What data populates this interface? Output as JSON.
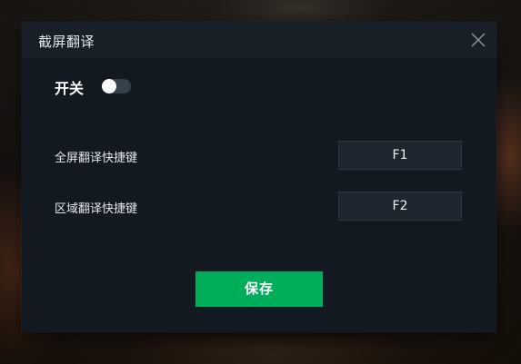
{
  "dialog": {
    "title": "截屏翻译",
    "close_icon": "close-icon"
  },
  "toggle": {
    "label": "开关",
    "state": "off"
  },
  "hotkeys": [
    {
      "label": "全屏翻译快捷键",
      "value": "F1"
    },
    {
      "label": "区域翻译快捷键",
      "value": "F2"
    }
  ],
  "footer": {
    "save_label": "保存"
  },
  "colors": {
    "accent": "#00ad5a",
    "dialog_bg": "#131920",
    "titlebar_bg": "#181f27",
    "input_bg": "#1d252e"
  }
}
